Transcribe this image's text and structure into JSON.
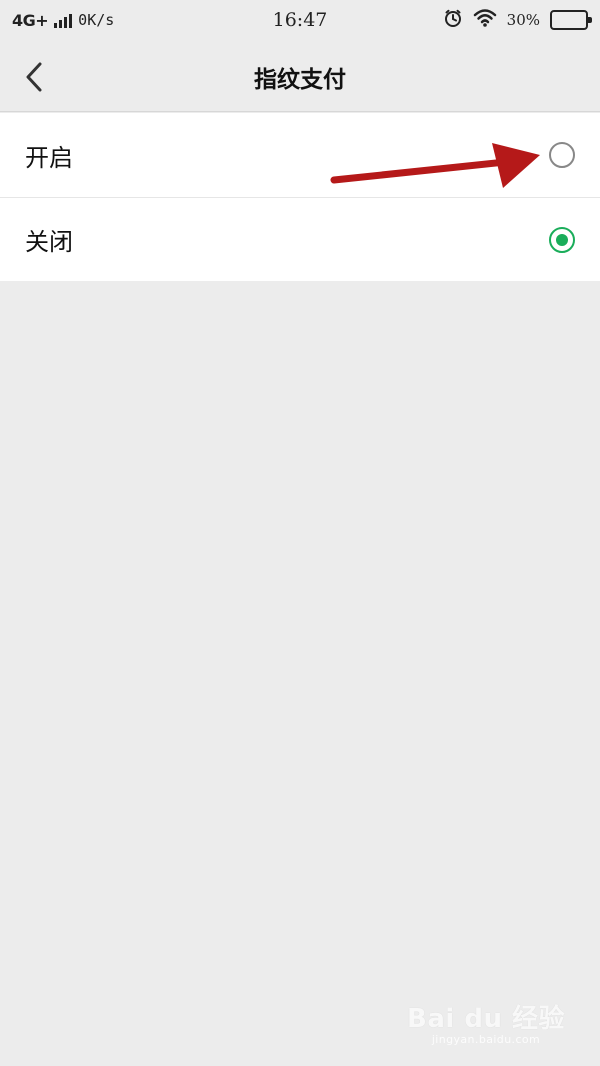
{
  "status_bar": {
    "network": "4G+",
    "speed": "0K/s",
    "time": "16:47",
    "battery_percent": "30%",
    "battery_level": 0.3,
    "signal_bars": 4
  },
  "nav": {
    "title": "指纹支付",
    "back_icon": "chevron-left-icon"
  },
  "options": [
    {
      "label": "开启",
      "selected": false
    },
    {
      "label": "关闭",
      "selected": true
    }
  ],
  "colors": {
    "background": "#ececec",
    "row_bg": "#ffffff",
    "accent": "#1aad5a",
    "annotation": "#b51919"
  },
  "watermark": {
    "main": "Bai du 经验",
    "sub": "jingyan.baidu.com"
  }
}
